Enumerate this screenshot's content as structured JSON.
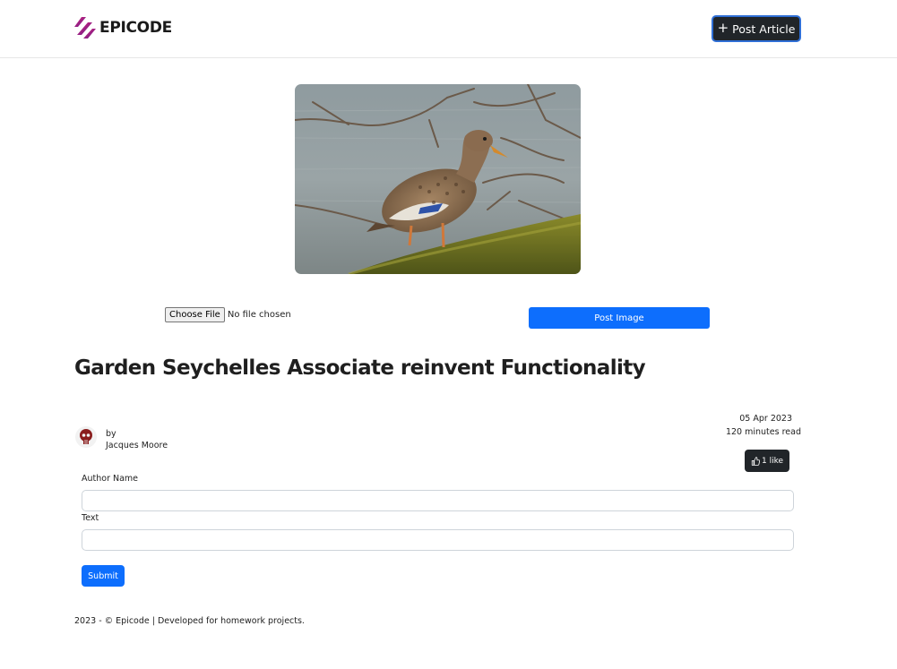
{
  "header": {
    "brand": "EPICODE",
    "post_article_label": "Post Article"
  },
  "upload": {
    "choose_file_label": "Choose File",
    "file_status": "No file chosen",
    "post_image_label": "Post Image"
  },
  "article": {
    "title": "Garden Seychelles Associate reinvent Functionality",
    "by_label": "by",
    "author": "Jacques Moore",
    "date": "05 Apr 2023",
    "read_time": "120 minutes read",
    "likes_label": "1 like"
  },
  "comment_form": {
    "author_label": "Author Name",
    "author_value": "",
    "text_label": "Text",
    "text_value": "",
    "submit_label": "Submit"
  },
  "footer": {
    "text": "2023 - © Epicode | Developed for homework projects."
  },
  "colors": {
    "primary": "#0d6efd",
    "dark": "#212529",
    "brand_gradient_start": "#e0247a",
    "brand_gradient_end": "#5b1d8c"
  }
}
